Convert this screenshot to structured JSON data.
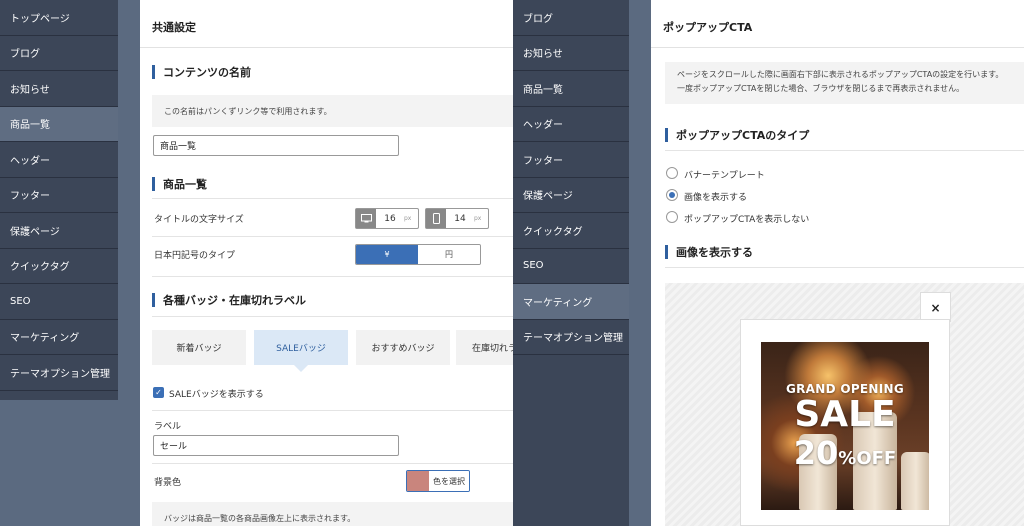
{
  "sidebar_left": {
    "items": [
      {
        "label": "トップページ",
        "active": false
      },
      {
        "label": "ブログ",
        "active": false
      },
      {
        "label": "お知らせ",
        "active": false
      },
      {
        "label": "商品一覧",
        "active": true
      },
      {
        "label": "ヘッダー",
        "active": false
      },
      {
        "label": "フッター",
        "active": false
      },
      {
        "label": "保護ページ",
        "active": false
      },
      {
        "label": "クイックタグ",
        "active": false
      },
      {
        "label": "SEO",
        "active": false
      },
      {
        "label": "マーケティング",
        "active": false
      },
      {
        "label": "テーマオプション管理",
        "active": false
      }
    ]
  },
  "sidebar_right": {
    "items": [
      {
        "label": "ブログ"
      },
      {
        "label": "お知らせ"
      },
      {
        "label": "商品一覧"
      },
      {
        "label": "ヘッダー"
      },
      {
        "label": "フッター"
      },
      {
        "label": "保護ページ"
      },
      {
        "label": "クイックタグ"
      },
      {
        "label": "SEO"
      },
      {
        "label": "マーケティング",
        "active": true
      },
      {
        "label": "テーマオプション管理"
      }
    ]
  },
  "panel_left": {
    "header": "共通設定",
    "content_name": {
      "title": "コンテンツの名前",
      "desc": "この名前はパンくずリンク等で利用されます。",
      "value": "商品一覧"
    },
    "product_list": {
      "title": "商品一覧",
      "title_size_label": "タイトルの文字サイズ",
      "pc_size": "16",
      "sp_size": "14",
      "unit": "px",
      "yen_label": "日本円記号のタイプ",
      "yen_opt1": "¥",
      "yen_opt2": "円"
    },
    "badges": {
      "title": "各種バッジ・在庫切れラベル",
      "tabs": [
        "新着バッジ",
        "SALEバッジ",
        "おすすめバッジ",
        "在庫切れラ"
      ],
      "selected_tab": 1,
      "show_label": "SALEバッジを表示する",
      "label_title": "ラベル",
      "label_value": "セール",
      "bg_label": "背景色",
      "bg_button": "色を選択",
      "bg_color": "#c9857d",
      "note": "バッジは商品一覧の各商品画像左上に表示されます。"
    }
  },
  "panel_right": {
    "header": "ポップアップCTA",
    "desc_line1": "ページをスクロールした際に画面右下部に表示されるポップアップCTAの設定を行います。",
    "desc_line2": "一度ポップアップCTAを閉じた場合、ブラウザを閉じるまで再表示されません。",
    "type_title": "ポップアップCTAのタイプ",
    "options": [
      "バナーテンプレート",
      "画像を表示する",
      "ポップアップCTAを表示しない"
    ],
    "selected_option": 1,
    "image_title": "画像を表示する",
    "close_symbol": "×",
    "sale_image": {
      "line1": "GRAND OPENING",
      "line2": "SALE",
      "line3a": "20",
      "line3b": "%OFF"
    }
  },
  "colors": {
    "accent": "#3b6fb6",
    "sidebar": "#3c4658",
    "sidebar_active": "#5f6d82"
  }
}
